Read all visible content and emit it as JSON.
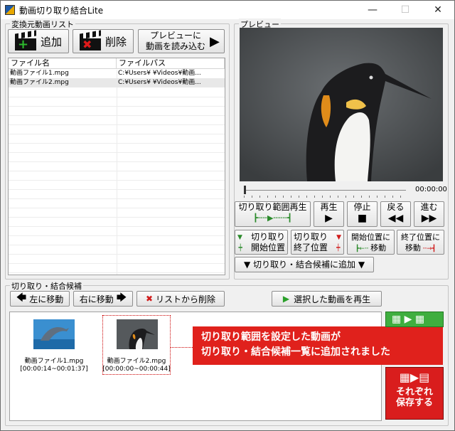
{
  "window": {
    "title": "動画切り取り結合Lite",
    "minimize": "—",
    "maximize": "☐",
    "close": "✕"
  },
  "source_list": {
    "group_label": "変換元動画リスト",
    "add_label": "追加",
    "delete_label": "削除",
    "load_preview_line1": "プレビューに",
    "load_preview_line2": "動画を読み込む",
    "columns": [
      "ファイル名",
      "ファイルパス"
    ],
    "rows": [
      {
        "name": "動画ファイル1.mpg",
        "path": "C:¥Users¥       ¥Videos¥動画..."
      },
      {
        "name": "動画ファイル2.mpg",
        "path": "C:¥Users¥       ¥Videos¥動画..."
      }
    ]
  },
  "preview": {
    "group_label": "プレビュー",
    "time": "00:00:00",
    "play_range_label": "切り取り範囲再生",
    "play_label": "再生",
    "stop_label": "停止",
    "back_label": "戻る",
    "forward_label": "進む",
    "set_start_line1": "切り取り",
    "set_start_line2": "開始位置",
    "set_end_line1": "切り取り",
    "set_end_line2": "終了位置",
    "goto_start_line1": "開始位置に",
    "goto_start_line2": "移動",
    "goto_end_line1": "終了位置に",
    "goto_end_line2": "移動",
    "add_candidate_label": "切り取り・結合候補に追加"
  },
  "candidates": {
    "group_label": "切り取り・結合候補",
    "move_left_label": "左に移動",
    "move_right_label": "右に移動",
    "remove_label": "リストから削除",
    "play_selected_label": "選択した動画を再生",
    "items": [
      {
        "name": "動画ファイル1.mpg",
        "range": "[00:00:14~00:01:37]"
      },
      {
        "name": "動画ファイル2.mpg",
        "range": "[00:00:00~00:00:44]"
      }
    ],
    "callout_line1": "切り取り範囲を設定した動画が",
    "callout_line2": "切り取り・結合候補一覧に追加されました",
    "save_line1": "それぞれ",
    "save_line2": "保存する"
  },
  "colors": {
    "accent_red": "#e0211c",
    "green": "#3fae3f"
  }
}
